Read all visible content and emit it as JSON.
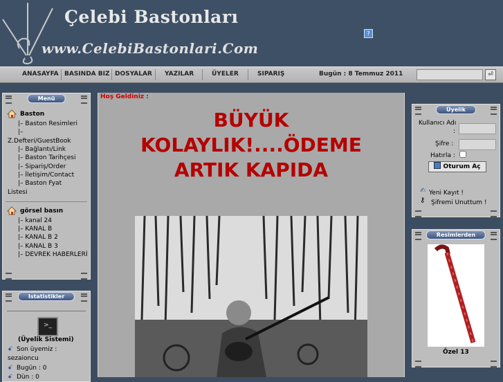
{
  "header": {
    "title": "Çelebi Bastonları",
    "url": "www.CelebiBastonlari.Com",
    "help_label": "?"
  },
  "nav": {
    "items": [
      "ANASAYFA",
      "BASINDA BIZ",
      "DOSYALAR",
      "YAZILAR",
      "ÜYELER",
      "SIPARIŞ"
    ],
    "today": "Bugün : 8 Temmuz 2011",
    "search_placeholder": "",
    "search_button": "⏎"
  },
  "menu_box": {
    "title": "Menü",
    "group1": {
      "heading": "Baston",
      "lines": [
        "|– Baston Resimleri",
        "|–",
        "Z.Defteri/GuestBook",
        "|– Bağlantı/Link",
        "|– Baston Tarihçesi",
        "|– Sipariş/Order",
        "|– İletişim/Contact",
        "|– Baston Fyat",
        "Listesi"
      ]
    },
    "group2": {
      "heading": "görsel basın",
      "lines": [
        "|– kanal 24",
        "|– KANAL B",
        "|– KANAL B 2",
        "|– KANAL B 3",
        "|– DEVREK HABERLERİ"
      ]
    }
  },
  "stats_box": {
    "title": "Istatistikler",
    "system": "(Üyelik Sistemi)",
    "last_member_label": "Son üyemiz :",
    "last_member": "sezaioncu",
    "today_label": "Bugün : 0",
    "yesterday_label": "Dün : 0"
  },
  "main": {
    "welcome": "Hoş Geldiniz :",
    "promo_lines": [
      "BÜYÜK",
      "KOLAYLIK!....ÖDEME",
      "ARTIK KAPIDA"
    ]
  },
  "members_box": {
    "title": "Üyelik",
    "username_label": "Kullanıcı Adı",
    "username_colon": ":",
    "password_label": "Şifre :",
    "remember_label": "Hatırla :",
    "login_button": "Oturum Aç",
    "register_link": "Yeni Kayıt !",
    "forgot_link": "Şifremi Unuttum !"
  },
  "pictures_box": {
    "title": "Resimlerden",
    "caption": "Özel 13"
  },
  "colors": {
    "background": "#3c4d62",
    "promo_red": "#b50000",
    "welcome_red": "#cc0000",
    "box_gray": "#bdbdbd"
  }
}
